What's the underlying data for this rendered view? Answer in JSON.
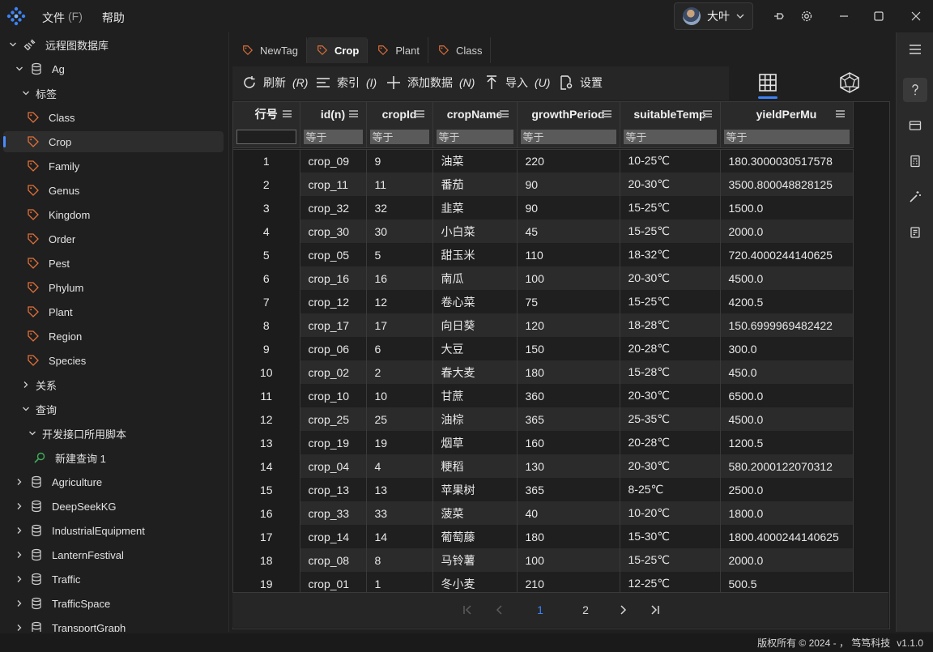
{
  "menu": {
    "file_label": "文件",
    "file_accel": "(F)",
    "help_label": "帮助"
  },
  "user": {
    "name": "大叶"
  },
  "sidebar": {
    "root_label": "远程图数据库",
    "db_label": "Ag",
    "tags_group": "标签",
    "tags": [
      "Class",
      "Crop",
      "Family",
      "Genus",
      "Kingdom",
      "Order",
      "Pest",
      "Phylum",
      "Plant",
      "Region",
      "Species"
    ],
    "selected_tag": "Crop",
    "relations_group": "关系",
    "query_group": "查询",
    "script_folder": "开发接口所用脚本",
    "new_query": "新建查询 1",
    "other_dbs": [
      "Agriculture",
      "DeepSeekKG",
      "IndustrialEquipment",
      "LanternFestival",
      "Traffic",
      "TrafficSpace",
      "TransportGraph"
    ]
  },
  "tabs": [
    {
      "label": "NewTag",
      "active": false
    },
    {
      "label": "Crop",
      "active": true
    },
    {
      "label": "Plant",
      "active": false
    },
    {
      "label": "Class",
      "active": false
    }
  ],
  "toolbar": {
    "refresh_label": "刷新",
    "refresh_accel": "(R)",
    "index_label": "索引",
    "index_accel": "(I)",
    "add_label": "添加数据",
    "add_accel": "(N)",
    "import_label": "导入",
    "import_accel": "(U)",
    "settings_label": "设置"
  },
  "table": {
    "columns": [
      "行号",
      "id(n)",
      "cropId",
      "cropName",
      "growthPeriod",
      "suitableTemp",
      "yieldPerMu"
    ],
    "filter_placeholder": "等于",
    "rows": [
      [
        "1",
        "crop_09",
        "9",
        "油菜",
        "220",
        "10-25℃",
        "180.3000030517578"
      ],
      [
        "2",
        "crop_11",
        "11",
        "番茄",
        "90",
        "20-30℃",
        "3500.800048828125"
      ],
      [
        "3",
        "crop_32",
        "32",
        "韭菜",
        "90",
        "15-25℃",
        "1500.0"
      ],
      [
        "4",
        "crop_30",
        "30",
        "小白菜",
        "45",
        "15-25℃",
        "2000.0"
      ],
      [
        "5",
        "crop_05",
        "5",
        "甜玉米",
        "110",
        "18-32℃",
        "720.4000244140625"
      ],
      [
        "6",
        "crop_16",
        "16",
        "南瓜",
        "100",
        "20-30℃",
        "4500.0"
      ],
      [
        "7",
        "crop_12",
        "12",
        "卷心菜",
        "75",
        "15-25℃",
        "4200.5"
      ],
      [
        "8",
        "crop_17",
        "17",
        "向日葵",
        "120",
        "18-28℃",
        "150.6999969482422"
      ],
      [
        "9",
        "crop_06",
        "6",
        "大豆",
        "150",
        "20-28℃",
        "300.0"
      ],
      [
        "10",
        "crop_02",
        "2",
        "春大麦",
        "180",
        "15-28℃",
        "450.0"
      ],
      [
        "11",
        "crop_10",
        "10",
        "甘蔗",
        "360",
        "20-30℃",
        "6500.0"
      ],
      [
        "12",
        "crop_25",
        "25",
        "油棕",
        "365",
        "25-35℃",
        "4500.0"
      ],
      [
        "13",
        "crop_19",
        "19",
        "烟草",
        "160",
        "20-28℃",
        "1200.5"
      ],
      [
        "14",
        "crop_04",
        "4",
        "粳稻",
        "130",
        "20-30℃",
        "580.2000122070312"
      ],
      [
        "15",
        "crop_13",
        "13",
        "苹果树",
        "365",
        "8-25℃",
        "2500.0"
      ],
      [
        "16",
        "crop_33",
        "33",
        "菠菜",
        "40",
        "10-20℃",
        "1800.0"
      ],
      [
        "17",
        "crop_14",
        "14",
        "葡萄藤",
        "180",
        "15-30℃",
        "1800.4000244140625"
      ],
      [
        "18",
        "crop_08",
        "8",
        "马铃薯",
        "100",
        "15-25℃",
        "2000.0"
      ],
      [
        "19",
        "crop_01",
        "1",
        "冬小麦",
        "210",
        "12-25℃",
        "500.5"
      ]
    ]
  },
  "pagination": {
    "current": "1",
    "next": "2"
  },
  "status": {
    "copyright": "版权所有 © 2024 - ， 笃笃科技",
    "version": "v1.1.0"
  },
  "colors": {
    "accent": "#4a8cff",
    "tag_icon": "#e0703a",
    "query_icon": "#3fae5a"
  }
}
